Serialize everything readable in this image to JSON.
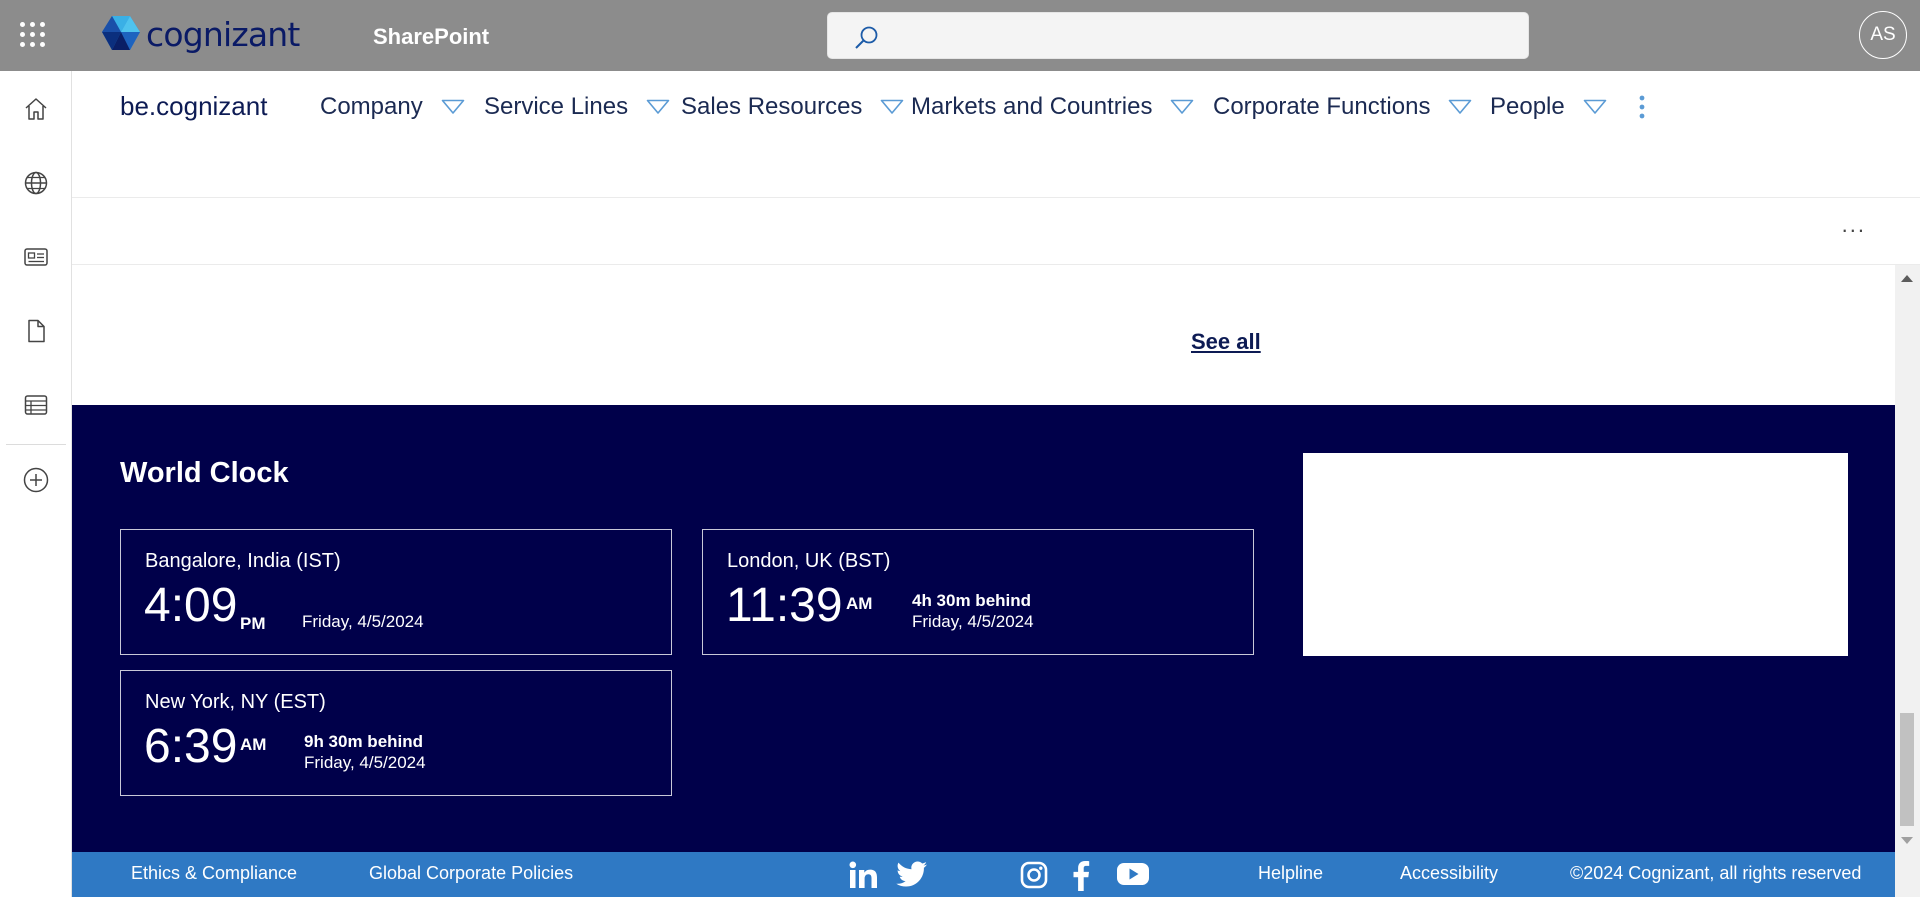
{
  "suite_bar": {
    "app_launcher_icon": "waffle-icon",
    "logo_text": "cognizant",
    "app_name": "SharePoint",
    "search_placeholder": "",
    "user_initials": "AS"
  },
  "left_rail": {
    "items": [
      {
        "icon": "home-icon"
      },
      {
        "icon": "globe-icon"
      },
      {
        "icon": "news-icon"
      },
      {
        "icon": "document-icon"
      },
      {
        "icon": "list-icon"
      },
      {
        "icon": "add-circle-icon"
      }
    ]
  },
  "hub_nav": {
    "site_title": "be.cognizant",
    "items": [
      {
        "label": "Company"
      },
      {
        "label": "Service Lines"
      },
      {
        "label": "Sales Resources"
      },
      {
        "label": "Markets and Countries"
      },
      {
        "label": "Corporate Functions"
      },
      {
        "label": "People"
      }
    ],
    "more_icon": "more-vertical-icon"
  },
  "command_bar": {
    "more_label": "..."
  },
  "main": {
    "see_all": "See all"
  },
  "world_clock": {
    "title": "World Clock",
    "clocks": [
      {
        "city": "Bangalore, India (IST)",
        "time": "4:09",
        "ampm": "PM",
        "diff": "",
        "date": "Friday, 4/5/2024"
      },
      {
        "city": "London, UK (BST)",
        "time": "11:39",
        "ampm": "AM",
        "diff": "4h 30m behind",
        "date": "Friday, 4/5/2024"
      },
      {
        "city": "New York, NY (EST)",
        "time": "6:39",
        "ampm": "AM",
        "diff": "9h 30m behind",
        "date": "Friday, 4/5/2024"
      }
    ]
  },
  "footer": {
    "links": [
      "Ethics & Compliance",
      "Global Corporate Policies",
      "Helpline",
      "Accessibility"
    ],
    "copyright": "©2024 Cognizant, all rights reserved",
    "social_icons": [
      "linkedin-icon",
      "twitter-icon",
      "instagram-icon",
      "facebook-icon",
      "youtube-icon"
    ]
  },
  "colors": {
    "suite_bar": "#8c8c8c",
    "clock_bg": "#00004a",
    "footer_bg": "#2f79c4",
    "nav_text": "#1b2a52",
    "chevron": "#5b9bd5"
  }
}
